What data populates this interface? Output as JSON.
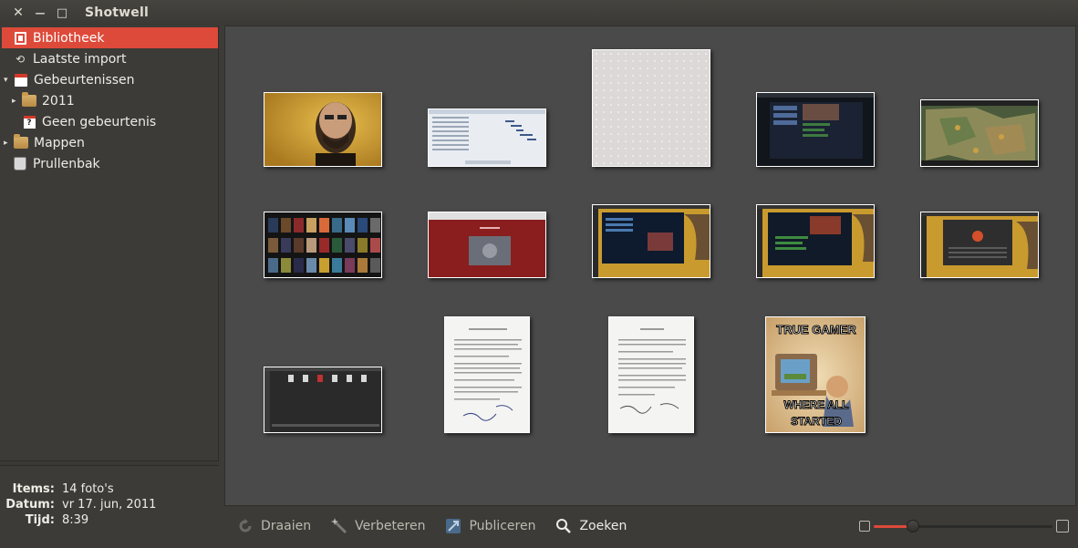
{
  "window": {
    "title": "Shotwell",
    "close_glyph": "✕",
    "minimize_glyph": "—",
    "maximize_glyph": "□"
  },
  "sidebar": {
    "items": [
      {
        "label": "Bibliotheek",
        "icon": "library-icon",
        "selected": true
      },
      {
        "label": "Laatste import",
        "icon": "last-import-icon",
        "glyph": "⟲"
      },
      {
        "label": "Gebeurtenissen",
        "icon": "events-icon",
        "expanded": true
      },
      {
        "label": "2011",
        "icon": "folder-icon",
        "expanded": false
      },
      {
        "label": "Geen gebeurtenis",
        "icon": "no-event-icon",
        "glyph": "?"
      },
      {
        "label": "Mappen",
        "icon": "folder-icon",
        "expanded": false
      },
      {
        "label": "Prullenbak",
        "icon": "trash-icon"
      }
    ],
    "expander_collapsed": "▸",
    "expander_expanded": "▾"
  },
  "info": {
    "items_label": "Items:",
    "items_value": "14 foto's",
    "date_label": "Datum:",
    "date_value": "vr 17. jun, 2011",
    "time_label": "Tijd:",
    "time_value": "8:39"
  },
  "thumbnails": [
    {
      "name": "breaking-bad-photo"
    },
    {
      "name": "spreadsheet-screenshot"
    },
    {
      "name": "pattern-texture"
    },
    {
      "name": "game-ui-screenshot-1"
    },
    {
      "name": "strategy-game-map"
    },
    {
      "name": "movie-library-grid"
    },
    {
      "name": "red-webpage-screenshot"
    },
    {
      "name": "desktop-screenshot-1"
    },
    {
      "name": "desktop-screenshot-2"
    },
    {
      "name": "desktop-screenshot-3"
    },
    {
      "name": "file-manager-screenshot"
    },
    {
      "name": "scanned-document-1"
    },
    {
      "name": "scanned-document-2"
    },
    {
      "name": "true-gamer-meme",
      "text_top": "TRUE GAMER",
      "text_bottom_1": "WHERE ALL",
      "text_bottom_2": "STARTED"
    }
  ],
  "toolbar": {
    "rotate_label": "Draaien",
    "enhance_label": "Verbeteren",
    "publish_label": "Publiceren",
    "search_label": "Zoeken"
  },
  "zoom": {
    "level": 0.22
  },
  "colors": {
    "accent": "#dd4a3a",
    "background": "#3c3b37",
    "content_bg": "#4a4a4a"
  }
}
